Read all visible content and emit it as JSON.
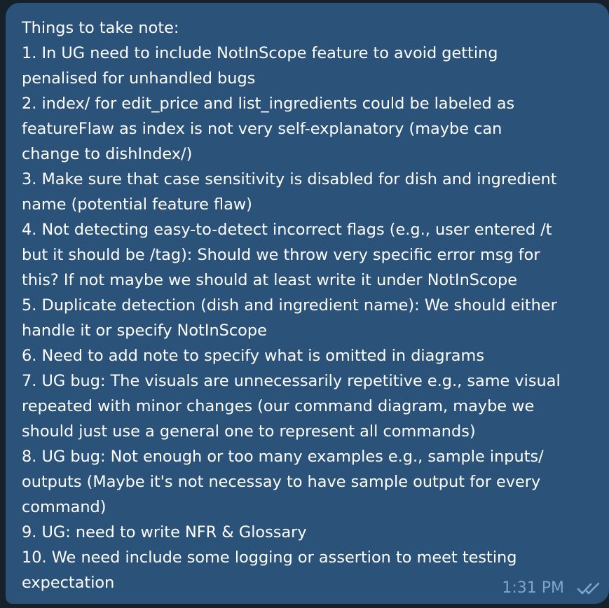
{
  "message": {
    "lines": [
      "Things to take note:",
      "1. In UG need to include NotInScope feature to avoid getting",
      "penalised for unhandled bugs",
      "2. index/ for edit_price and list_ingredients could be labeled as",
      "featureFlaw as index is not very self-explanatory (maybe can",
      "change to dishIndex/)",
      "3. Make sure that case sensitivity is disabled for dish and ingredient",
      "name (potential feature flaw)",
      "4. Not detecting easy-to-detect incorrect flags (e.g., user entered /t",
      "but it should be /tag): Should we throw very specific error msg for",
      "this? If not maybe we should at least write it under NotInScope",
      "5. Duplicate detection (dish and ingredient name): We should either",
      "handle it or specify NotInScope",
      "6. Need to add note to specify what is omitted in diagrams",
      "7. UG bug: The visuals are unnecessarily repetitive e.g., same visual",
      "repeated with minor changes (our command diagram, maybe we",
      "should just use a general one to represent all commands)",
      "8. UG bug: Not enough or too many examples e.g., sample inputs/",
      "outputs (Maybe it's not necessay to have sample output for every",
      "command)",
      "9. UG: need to write NFR & Glossary",
      "10. We need include some logging or assertion to meet testing",
      "expectation"
    ],
    "time": "1:31 PM",
    "status_icon": "double-check-icon"
  },
  "colors": {
    "background": "#17212b",
    "bubble": "#2b5278",
    "text": "#ffffff",
    "meta": "#7fa5c8"
  }
}
